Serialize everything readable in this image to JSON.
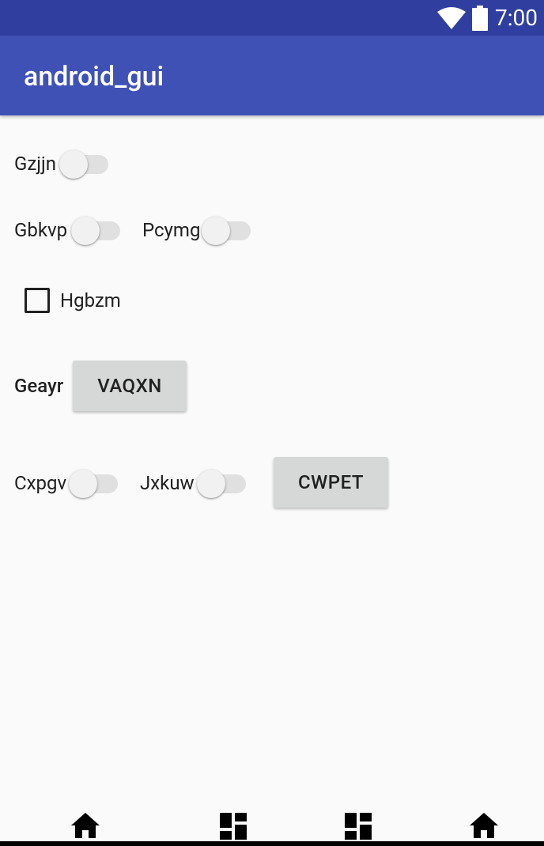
{
  "status_bar": {
    "time": "7:00",
    "wifi_icon": "wifi-icon",
    "battery_icon": "battery-icon"
  },
  "app_bar": {
    "title": "android_gui"
  },
  "controls": {
    "switch_gzjjn": {
      "label": "Gzjjn",
      "checked": false
    },
    "switch_gbkvp": {
      "label": "Gbkvp",
      "checked": false
    },
    "switch_pcymg": {
      "label": "Pcymg",
      "checked": false
    },
    "checkbox_hgbzm": {
      "label": "Hgbzm",
      "checked": false
    },
    "geayr": {
      "label": "Geayr",
      "button_label": "VAQXN"
    },
    "switch_cxpgv": {
      "label": "Cxpgv",
      "checked": false
    },
    "switch_jxkuw": {
      "label": "Jxkuw",
      "checked": false
    },
    "button_cwpet": {
      "label": "CWPET"
    }
  },
  "bottom_nav": {
    "items": [
      {
        "icon": "home-icon"
      },
      {
        "icon": "dashboard-icon"
      },
      {
        "icon": "dashboard-icon"
      },
      {
        "icon": "home-icon"
      }
    ]
  },
  "colors": {
    "status_bar": "#303f9f",
    "app_bar": "#3f51b5",
    "background": "#fafafa",
    "button": "#d6d7d7"
  }
}
